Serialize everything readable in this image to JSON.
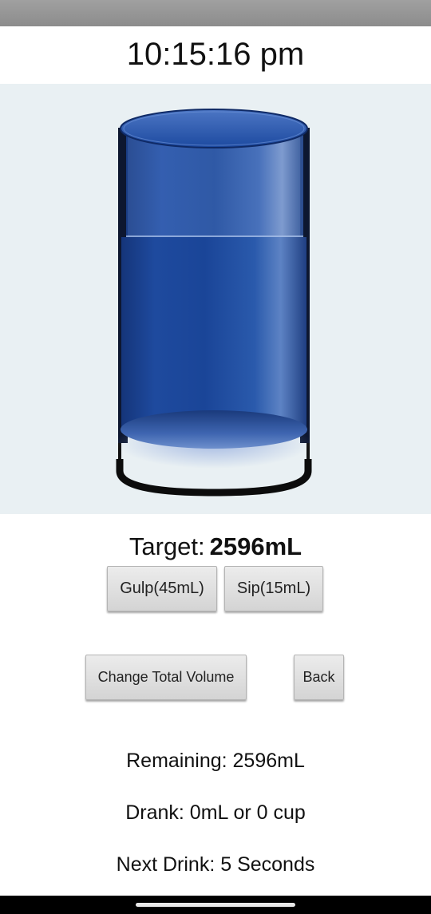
{
  "clock": {
    "time": "10:15:16 pm"
  },
  "glass": {
    "fill_level": 1.0,
    "water_color": "#1c4aa0",
    "background_color": "#e9f0f3"
  },
  "target": {
    "label": "Target:",
    "value": "2596mL"
  },
  "buttons": {
    "gulp": "Gulp(45mL)",
    "sip": "Sip(15mL)",
    "change_total": "Change Total Volume",
    "back": "Back"
  },
  "stats": {
    "remaining": "Remaining: 2596mL",
    "drank": "Drank: 0mL or 0 cup",
    "next_drink": "Next Drink: 5 Seconds"
  }
}
